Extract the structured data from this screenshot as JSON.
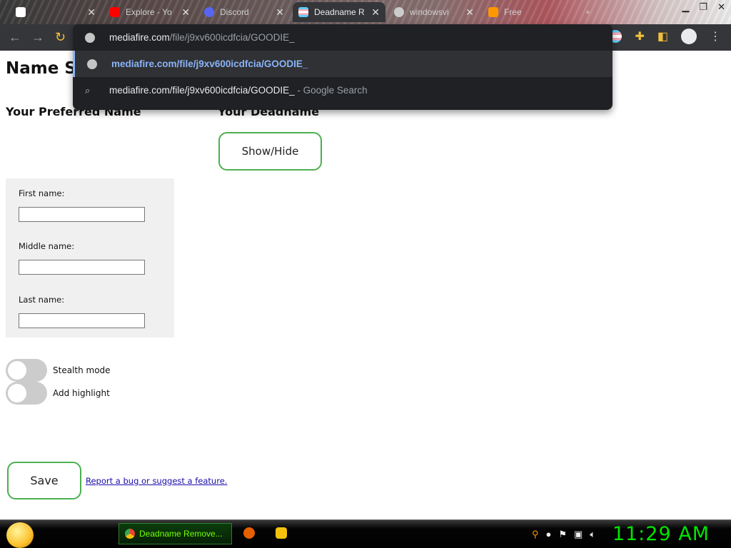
{
  "browser": {
    "tabs": [
      {
        "title": "",
        "active": false
      },
      {
        "title": "Explore - Yo",
        "active": false
      },
      {
        "title": "Discord",
        "active": false
      },
      {
        "title": "Deadname R",
        "active": true
      },
      {
        "title": "windowsvi",
        "active": false
      },
      {
        "title": "Free",
        "active": false
      }
    ],
    "new_tab": "+",
    "omnibox": {
      "input_host": "mediafire.com",
      "input_path": "/file/j9xv600icdfcia/GOODIE_",
      "suggestion_url": "mediafire.com/file/j9xv600icdfcia/GOODIE_",
      "search_query": "mediafire.com/file/j9xv600icdfcia/GOODIE_",
      "search_suffix": " - Google Search"
    }
  },
  "page": {
    "title": "Name Se",
    "preferred_heading": "Your Preferred Name",
    "deadname_heading": "Your Deadname",
    "show_hide_label": "Show/Hide",
    "fields": {
      "first_label": "First name:",
      "first_placeholder": "",
      "middle_label": "Middle name:",
      "middle_placeholder": "",
      "last_label": "Last name:",
      "last_placeholder": ""
    },
    "toggles": [
      {
        "label": "Stealth mode",
        "on": false
      },
      {
        "label": "Add highlight",
        "on": false
      }
    ],
    "save_label": "Save",
    "report_link": "Report a bug or suggest a feature."
  },
  "taskbar": {
    "active_task": "Deadname Remove...",
    "clock": "11:29 AM"
  },
  "colors": {
    "accent_green": "#4caf50",
    "omnibox_link": "#8ab4f8",
    "clock": "#00e600"
  }
}
